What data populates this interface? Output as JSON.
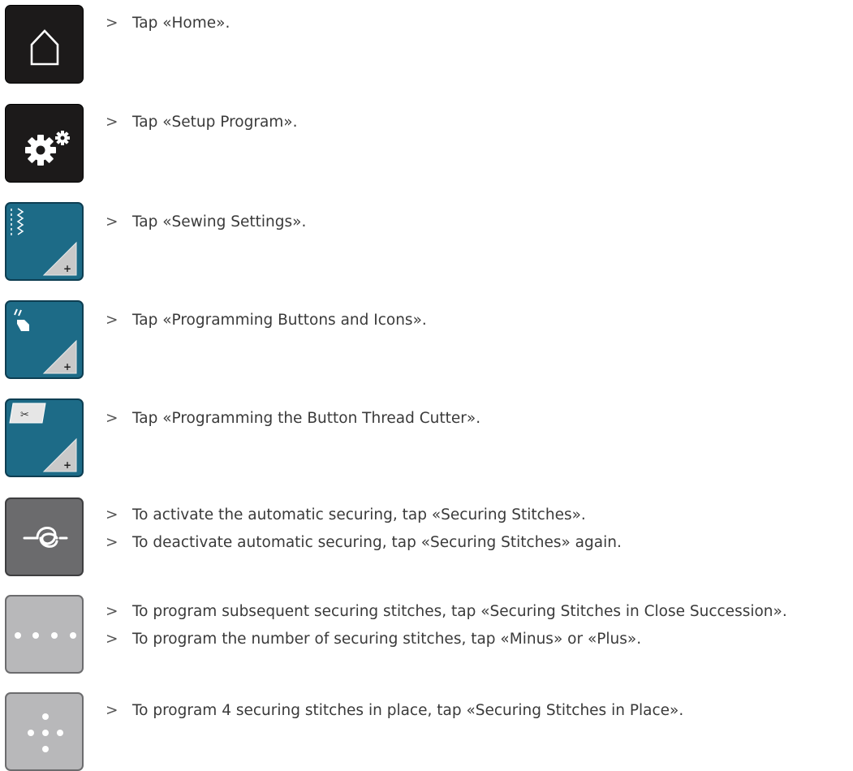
{
  "steps": [
    {
      "icon": "home-icon",
      "lines": [
        "Tap «Home»."
      ]
    },
    {
      "icon": "setup-program-icon",
      "lines": [
        "Tap «Setup Program»."
      ]
    },
    {
      "icon": "sewing-settings-icon",
      "lines": [
        "Tap «Sewing Settings»."
      ]
    },
    {
      "icon": "programming-buttons-icon",
      "lines": [
        "Tap «Programming Buttons and Icons»."
      ]
    },
    {
      "icon": "thread-cutter-icon",
      "lines": [
        "Tap «Programming the Button Thread Cutter»."
      ]
    },
    {
      "icon": "securing-stitches-icon",
      "lines": [
        "To activate the automatic securing, tap «Securing Stitches».",
        "To deactivate automatic securing, tap «Securing Stitches» again."
      ]
    },
    {
      "icon": "securing-close-succession-icon",
      "lines": [
        "To program subsequent securing stitches, tap «Securing Stitches in Close Succession».",
        "To program the number of securing stitches, tap «Minus» or «Plus»."
      ]
    },
    {
      "icon": "securing-in-place-icon",
      "lines": [
        "To program 4 securing stitches in place, tap «Securing Stitches in Place»."
      ]
    }
  ],
  "bullet": ">"
}
